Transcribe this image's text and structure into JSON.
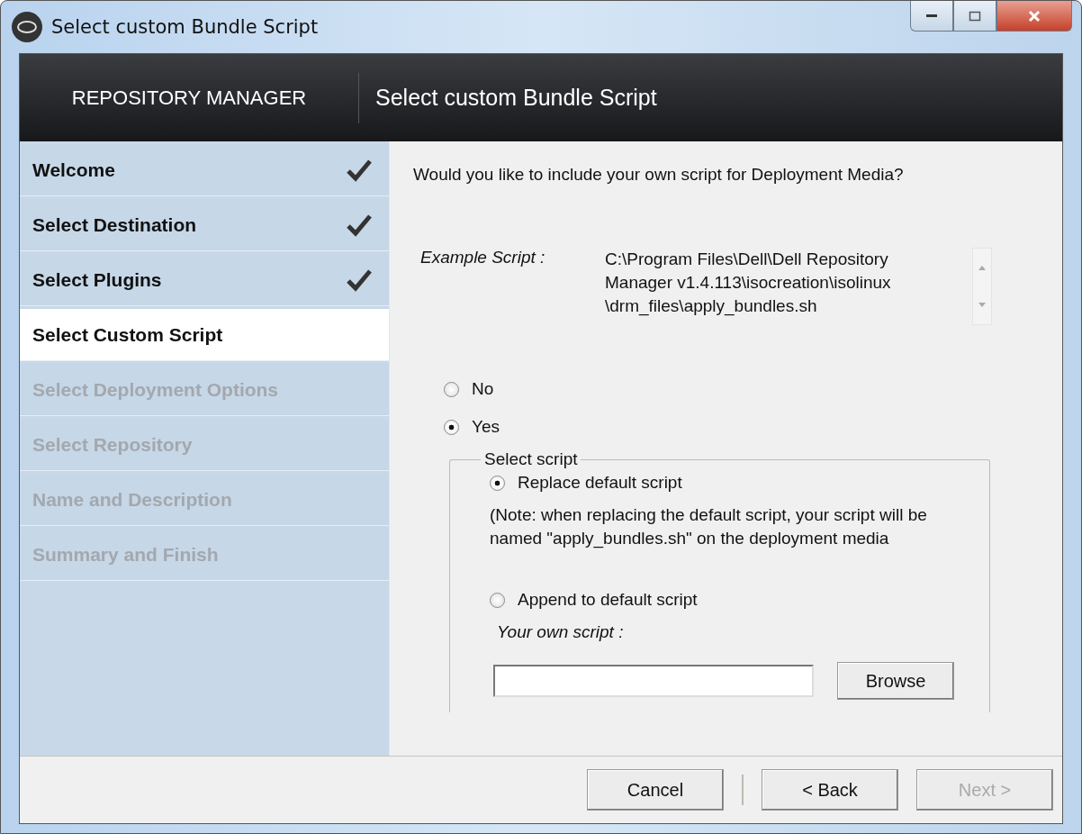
{
  "window": {
    "title": "Select custom Bundle Script"
  },
  "header": {
    "product": "REPOSITORY MANAGER",
    "page_title": "Select custom Bundle Script"
  },
  "steps": [
    {
      "label": "Welcome",
      "done": true,
      "selected": false,
      "disabled": false
    },
    {
      "label": "Select Destination",
      "done": true,
      "selected": false,
      "disabled": false
    },
    {
      "label": "Select Plugins",
      "done": true,
      "selected": false,
      "disabled": false
    },
    {
      "label": "Select Custom Script",
      "done": false,
      "selected": true,
      "disabled": false
    },
    {
      "label": "Select Deployment Options",
      "done": false,
      "selected": false,
      "disabled": true
    },
    {
      "label": "Select Repository",
      "done": false,
      "selected": false,
      "disabled": true
    },
    {
      "label": "Name and Description",
      "done": false,
      "selected": false,
      "disabled": true
    },
    {
      "label": "Summary and Finish",
      "done": false,
      "selected": false,
      "disabled": true
    }
  ],
  "question": "Would you like to include your own script for Deployment Media?",
  "example": {
    "label": "Example Script :",
    "value": "C:\\Program Files\\Dell\\Dell Repository Manager v1.4.113\\isocreation\\isolinux \\drm_files\\apply_bundles.sh"
  },
  "include_options": [
    {
      "label": "No",
      "selected": false
    },
    {
      "label": "Yes",
      "selected": true
    }
  ],
  "select_script": {
    "title": "Select script",
    "options": [
      {
        "label": "Replace default script",
        "selected": true,
        "note": "(Note: when replacing the default script, your script will be named \"apply_bundles.sh\" on the deployment media"
      },
      {
        "label": "Append to default script",
        "selected": false
      }
    ],
    "own_script_label": "Your own script :",
    "browse": "Browse"
  },
  "buttons": [
    {
      "label": "Cancel",
      "disabled": false
    },
    {
      "label": "< Back",
      "disabled": false
    },
    {
      "label": "Next >",
      "disabled": true
    }
  ]
}
